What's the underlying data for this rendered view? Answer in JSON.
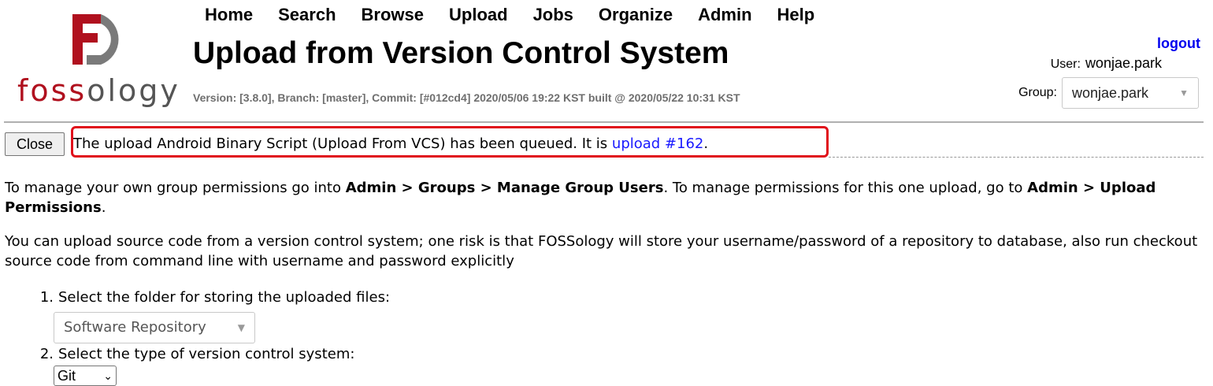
{
  "logo": {
    "text_fos": "foss",
    "text_ology": "ology",
    "colors": {
      "brand_red": "#b0101e",
      "gray": "#555555"
    }
  },
  "nav": [
    "Home",
    "Search",
    "Browse",
    "Upload",
    "Jobs",
    "Organize",
    "Admin",
    "Help"
  ],
  "page": {
    "title": "Upload from Version Control System",
    "version": "Version: [3.8.0], Branch: [master], Commit: [#012cd4] 2020/05/06 19:22 KST built @ 2020/05/22 10:31 KST"
  },
  "account": {
    "logout": "logout",
    "user_label": "User:",
    "user_name": "wonjae.park",
    "group_label": "Group:",
    "group_value": "wonjae.park"
  },
  "message": {
    "close_label": "Close",
    "text": "The upload Android Binary Script (Upload From VCS) has been queued. It is ",
    "link": "upload #162",
    "tail": "."
  },
  "info": {
    "p1_a": "To manage your own group permissions go into ",
    "p1_b": "Admin > Groups > Manage Group Users",
    "p1_c": ". To manage permissions for this one upload, go to ",
    "p1_d": "Admin > Upload Permissions",
    "p1_e": ".",
    "p2": "You can upload source code from a version control system; one risk is that FOSSology will store your username/password of a repository to database, also run checkout source code from command line with username and password explicitly"
  },
  "steps": [
    {
      "num": "1.",
      "label": "Select the folder for storing the uploaded files:",
      "value": "Software Repository"
    },
    {
      "num": "2.",
      "label": "Select the type of version control system:",
      "value": "Git"
    }
  ]
}
